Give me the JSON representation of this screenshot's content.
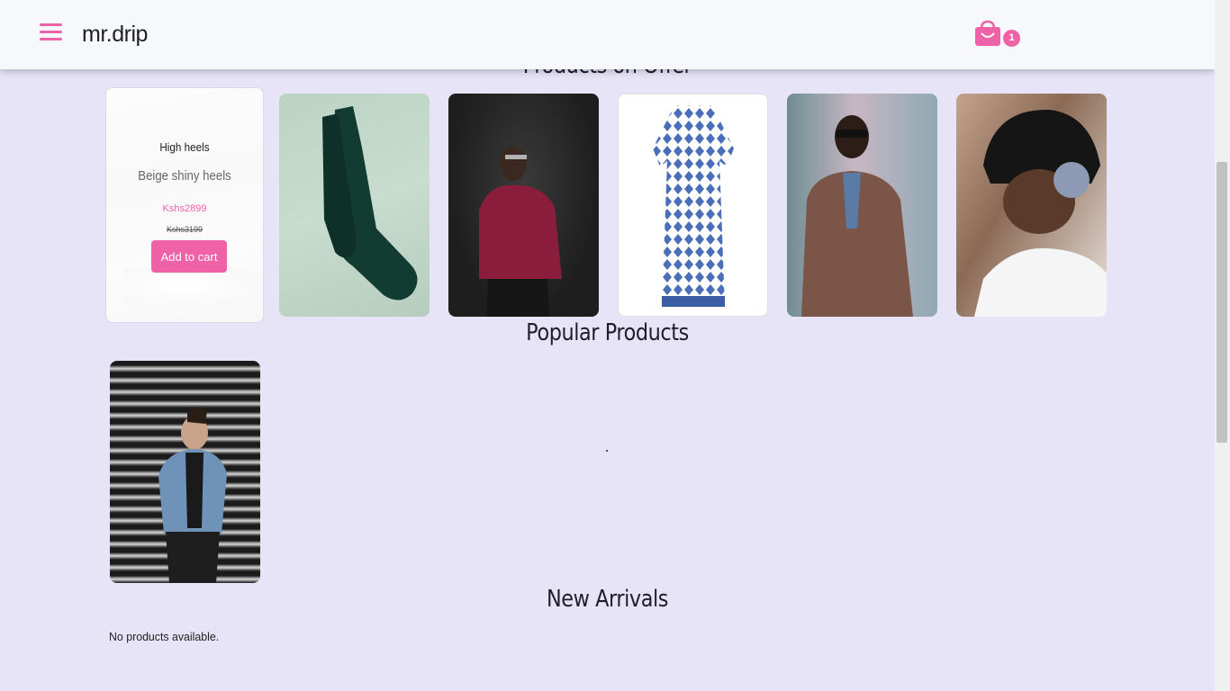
{
  "navbar": {
    "brand": "mr.drip",
    "menu_icon": "hamburger-menu-icon",
    "cart_icon": "shopping-bag-icon",
    "cart_count": "1",
    "accent": "#f062a8"
  },
  "sections": {
    "offer_title": "Products on Offer",
    "popular_title": "Popular Products",
    "new_title": "New Arrivals",
    "new_empty": "No products available."
  },
  "offer_highlight": {
    "category": "High heels",
    "name": "Beige shiny heels",
    "price": "Kshs2899",
    "old_price": "Kshs3199",
    "button": "Add to cart"
  },
  "offer_products": [
    {
      "image": "green-socks"
    },
    {
      "image": "man-red-sweater"
    },
    {
      "image": "blue-pattern-dress"
    },
    {
      "image": "man-brown-jacket"
    },
    {
      "image": "woman-black-beanie-headphones"
    }
  ],
  "popular_products": [
    {
      "image": "man-denim-jacket"
    }
  ]
}
